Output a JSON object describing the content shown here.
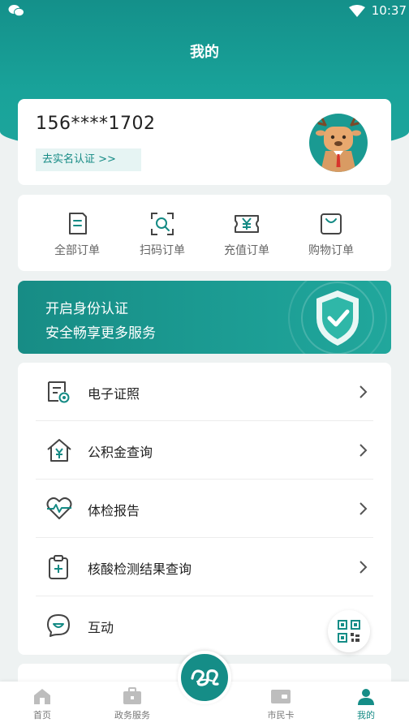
{
  "status_bar": {
    "time": "10:37"
  },
  "header": {
    "title": "我的"
  },
  "profile": {
    "phone": "156****1702",
    "verify_label": "去实名认证 >>"
  },
  "orders": [
    {
      "label": "全部订单",
      "icon": "document-icon"
    },
    {
      "label": "扫码订单",
      "icon": "scan-search-icon"
    },
    {
      "label": "充值订单",
      "icon": "ticket-yuan-icon"
    },
    {
      "label": "购物订单",
      "icon": "shopping-bag-icon"
    }
  ],
  "banner": {
    "line1": "开启身份认证",
    "line2": "安全畅享更多服务"
  },
  "menu": [
    {
      "label": "电子证照",
      "icon": "certificate-icon"
    },
    {
      "label": "公积金查询",
      "icon": "house-yuan-icon"
    },
    {
      "label": "体检报告",
      "icon": "heart-pulse-icon"
    },
    {
      "label": "核酸检测结果查询",
      "icon": "clipboard-plus-icon"
    },
    {
      "label": "互动",
      "icon": "chat-smile-icon"
    }
  ],
  "tabs": [
    {
      "label": "首页",
      "icon": "home-icon"
    },
    {
      "label": "政务服务",
      "icon": "briefcase-icon"
    },
    {
      "label": "市民卡",
      "icon": "card-icon"
    },
    {
      "label": "我的",
      "icon": "user-icon"
    }
  ],
  "colors": {
    "accent": "#158d87",
    "header": "#19a39a"
  }
}
